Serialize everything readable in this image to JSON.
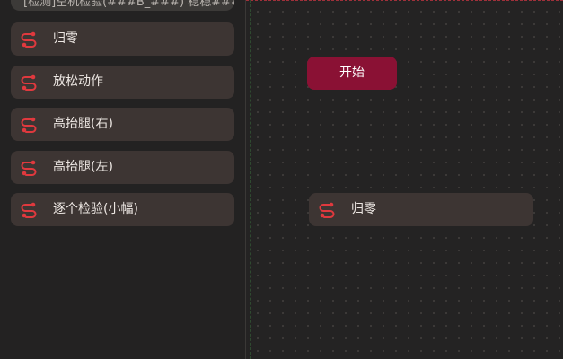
{
  "sidebar": {
    "search_text": "[检测]空机检验(###B_###) 稳稳####",
    "blocks": [
      {
        "label": "归零"
      },
      {
        "label": "放松动作"
      },
      {
        "label": "高抬腿(右)"
      },
      {
        "label": "高抬腿(左)"
      },
      {
        "label": "逐个检验(小幅)"
      }
    ]
  },
  "canvas": {
    "start_label": "开始",
    "placed_block": {
      "label": "归零"
    }
  },
  "colors": {
    "accent": "#8a1134",
    "block_bg": "#3d3533",
    "icon_red": "#e0393e"
  },
  "icons": {
    "block_icon": "route-s-curve-icon"
  }
}
